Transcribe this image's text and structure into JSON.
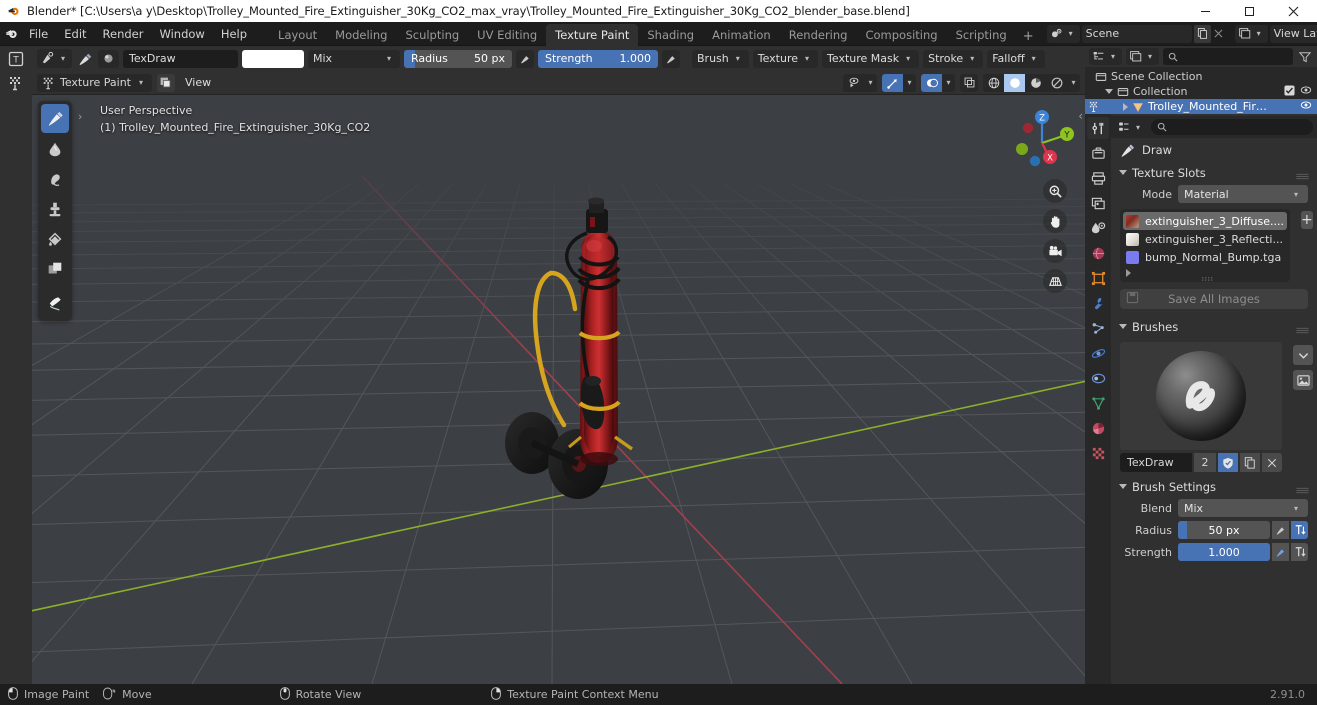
{
  "window": {
    "title": "Blender* [C:\\Users\\a y\\Desktop\\Trolley_Mounted_Fire_Extinguisher_30Kg_CO2_max_vray\\Trolley_Mounted_Fire_Extinguisher_30Kg_CO2_blender_base.blend]",
    "minimize_label": "Minimize",
    "maximize_label": "Restore",
    "close_label": "Close"
  },
  "topbar": {
    "menus": [
      "File",
      "Edit",
      "Render",
      "Window",
      "Help"
    ],
    "workspaces": [
      {
        "label": "Layout",
        "active": false
      },
      {
        "label": "Modeling",
        "active": false
      },
      {
        "label": "Sculpting",
        "active": false
      },
      {
        "label": "UV Editing",
        "active": false
      },
      {
        "label": "Texture Paint",
        "active": true
      },
      {
        "label": "Shading",
        "active": false
      },
      {
        "label": "Animation",
        "active": false
      },
      {
        "label": "Rendering",
        "active": false
      },
      {
        "label": "Compositing",
        "active": false
      },
      {
        "label": "Scripting",
        "active": false
      }
    ],
    "add_workspace": "+",
    "scene_name": "Scene",
    "view_layer_name": "View Layer"
  },
  "tool_header": {
    "brush_name": "TexDraw",
    "color_swatch": "#ffffff",
    "blend_mode": "Mix",
    "radius_label": "Radius",
    "radius_value": "50 px",
    "strength_label": "Strength",
    "strength_value": "1.000",
    "popovers": [
      "Brush",
      "Texture",
      "Texture Mask",
      "Stroke",
      "Falloff"
    ],
    "mode": "Texture Paint",
    "view_menu": "View"
  },
  "viewport": {
    "perspective": "User Perspective",
    "object_info": "(1) Trolley_Mounted_Fire_Extinguisher_30Kg_CO2",
    "background_color": "#3c3f44",
    "grid_color": "#585b60",
    "axis_x_color": "#a33f4d",
    "axis_y_color": "#7ba01f",
    "gizmo_axes": [
      {
        "label": "Z",
        "color": "#3b84d8"
      },
      {
        "label": "Y",
        "color": "#8fc31f"
      },
      {
        "label": "X",
        "color": "#e0344a"
      }
    ],
    "tools": [
      {
        "name": "draw",
        "active": true
      },
      {
        "name": "soften",
        "active": false
      },
      {
        "name": "smear",
        "active": false
      },
      {
        "name": "clone",
        "active": false
      },
      {
        "name": "fill",
        "active": false
      },
      {
        "name": "mask",
        "active": false
      },
      {
        "name": "annotate",
        "active": false
      }
    ],
    "nav_buttons": [
      "zoom",
      "pan",
      "camera",
      "ortho-toggle"
    ]
  },
  "outliner": {
    "rows": [
      {
        "label": "Scene Collection",
        "depth": 0,
        "selected": false,
        "has_checkbox": false,
        "has_eye": false
      },
      {
        "label": "Collection",
        "depth": 1,
        "selected": false,
        "has_checkbox": true,
        "has_eye": true
      },
      {
        "label": "Trolley_Mounted_Fir…",
        "depth": 2,
        "selected": true,
        "has_checkbox": false,
        "has_eye": true
      }
    ]
  },
  "properties": {
    "breadcrumb": "Draw",
    "tabs": [
      "tool-tab",
      "render-tab",
      "output-tab",
      "view-layer-tab",
      "scene-tab",
      "world-tab",
      "object-tab",
      "modifier-tab",
      "particles-tab",
      "physics-tab",
      "constraints-tab",
      "data-tab",
      "material-tab",
      "texture-tab"
    ],
    "texture_slots": {
      "title": "Texture Slots",
      "mode_label": "Mode",
      "mode_value": "Material",
      "slots": [
        {
          "name": "extinguisher_3_Diffuse....",
          "selected": true,
          "swatch": "#9e5542"
        },
        {
          "name": "extinguisher_3_Reflecti...",
          "selected": false,
          "swatch": "#e8e8e4"
        },
        {
          "name": "bump_Normal_Bump.tga",
          "selected": false,
          "swatch": "#7b7bf0"
        }
      ],
      "add_button": "+",
      "save_all_label": "Save All Images"
    },
    "brushes": {
      "title": "Brushes",
      "brush_name": "TexDraw",
      "users_count": "2",
      "fake_user_on": true
    },
    "brush_settings": {
      "title": "Brush Settings",
      "blend_label": "Blend",
      "blend_value": "Mix",
      "radius_label": "Radius",
      "radius_value": "50 px",
      "strength_label": "Strength",
      "strength_value": "1.000"
    }
  },
  "statusbar": {
    "items": [
      {
        "icon": "mouse-left",
        "label": "Image Paint"
      },
      {
        "icon": "mouse-move",
        "label": "Move"
      },
      {
        "icon": "mouse-middle",
        "label": "Rotate View"
      },
      {
        "icon": "mouse-right",
        "label": "Texture Paint Context Menu"
      }
    ],
    "version": "2.91.0"
  }
}
